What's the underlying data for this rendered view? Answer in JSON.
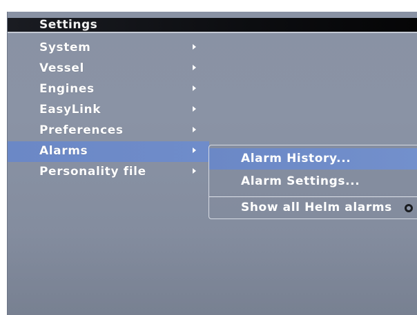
{
  "header": {
    "title": "Settings"
  },
  "menu": {
    "items": [
      {
        "label": "System"
      },
      {
        "label": "Vessel"
      },
      {
        "label": "Engines"
      },
      {
        "label": "EasyLink"
      },
      {
        "label": "Preferences"
      },
      {
        "label": "Alarms",
        "selected": true
      },
      {
        "label": "Personality file"
      }
    ]
  },
  "submenu": {
    "items": [
      {
        "label": "Alarm History...",
        "selected": true
      },
      {
        "label": "Alarm Settings..."
      },
      {
        "label": "Show all Helm alarms",
        "icon": "radio-icon"
      }
    ]
  },
  "colors": {
    "background": "#8a93a5",
    "title_bar": "#0c0d10",
    "highlight": "#6b88c6",
    "text": "#ffffff"
  }
}
